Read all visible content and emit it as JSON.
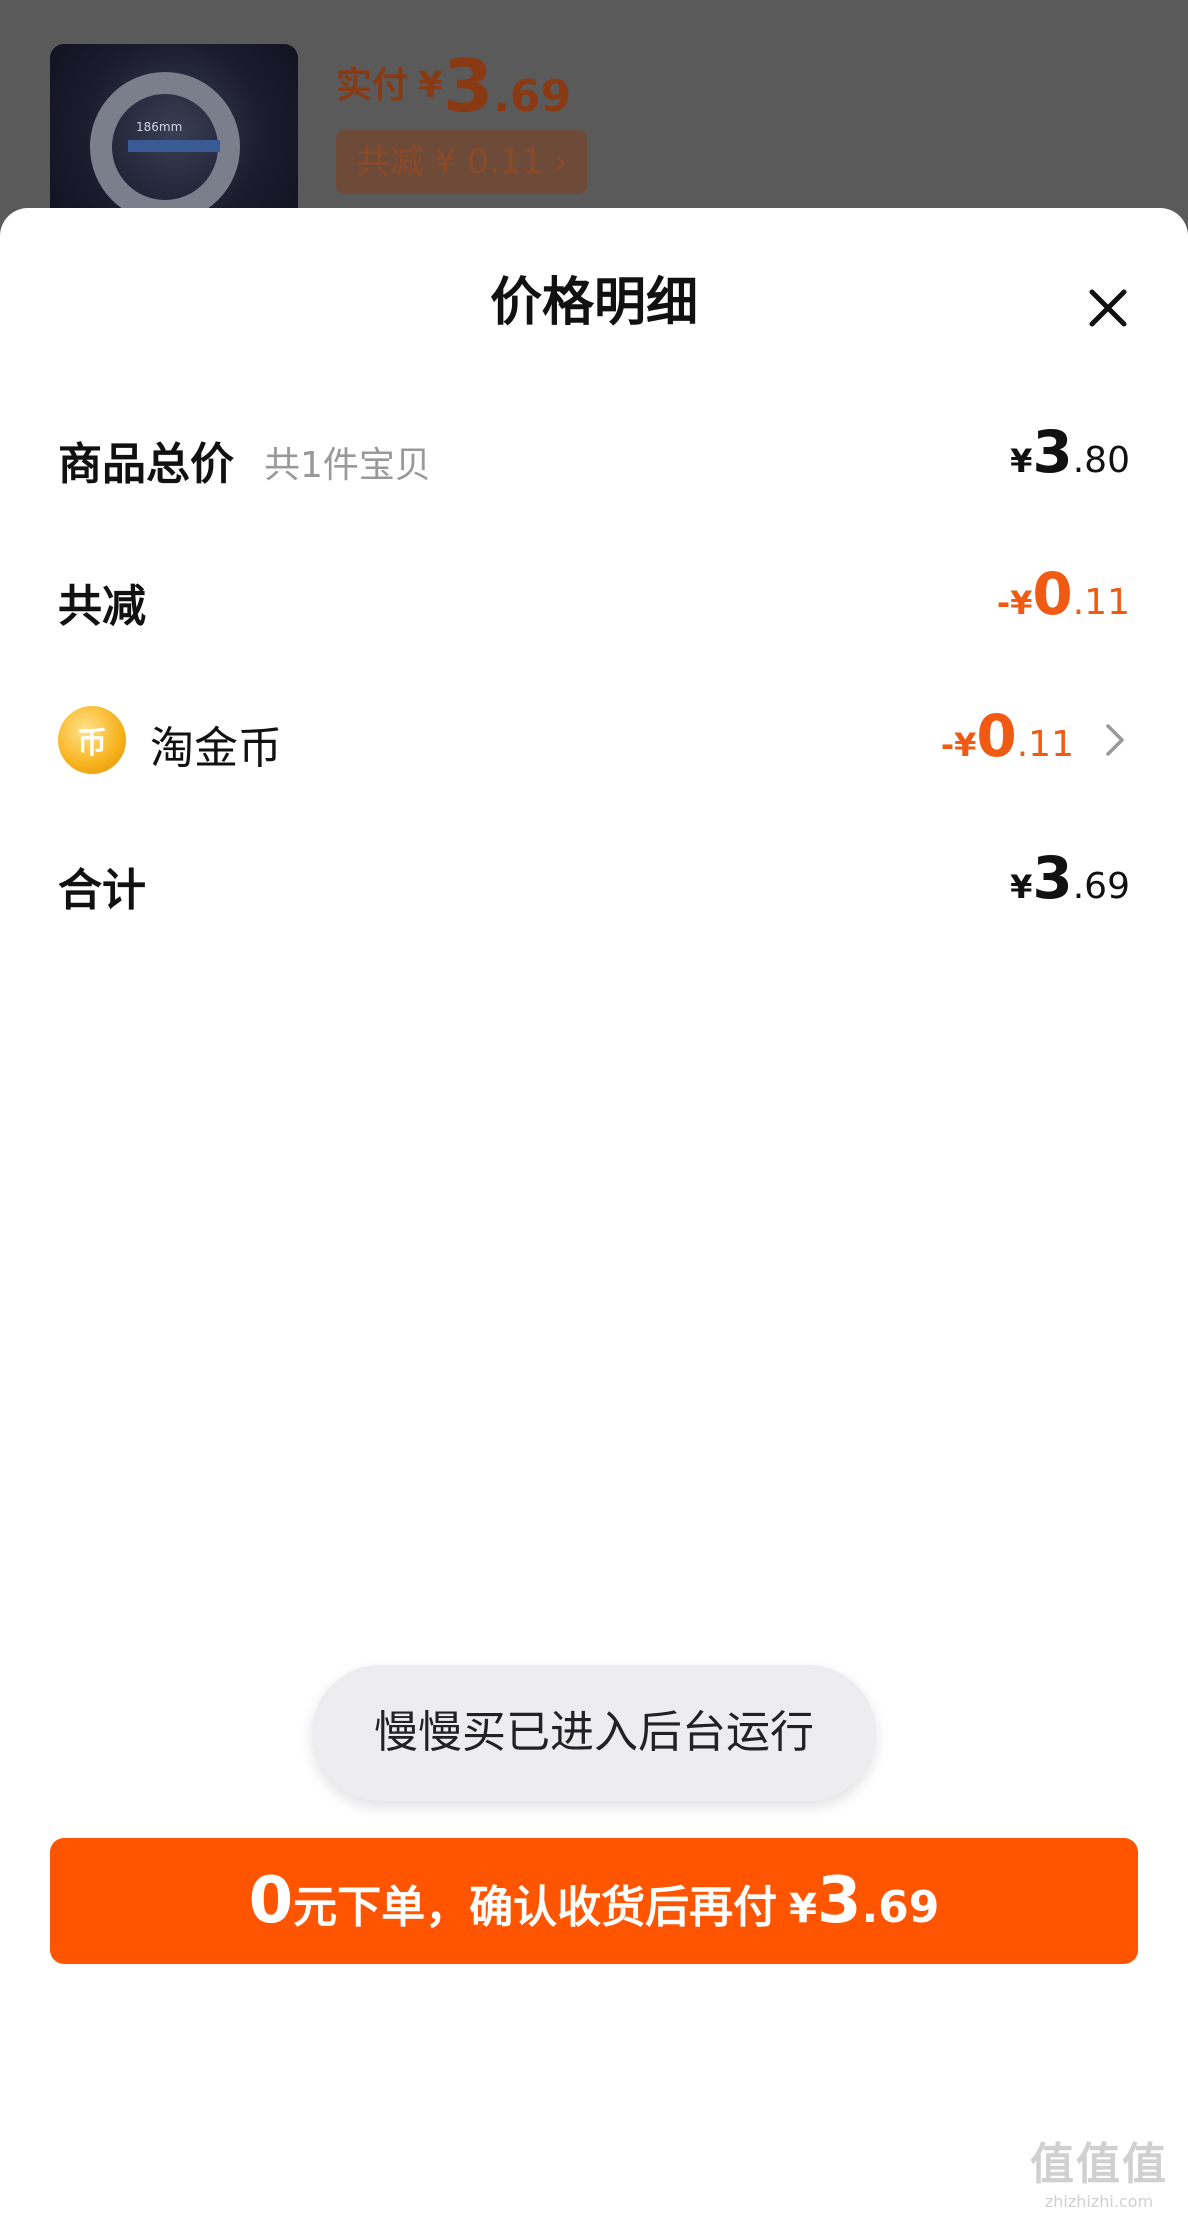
{
  "product": {
    "paid_label": "实付",
    "currency": "¥",
    "paid_int": "3",
    "paid_dec": ".69",
    "discount_chip": "共减 ¥ 0.11 ›",
    "thumb_label": "186mm"
  },
  "sheet": {
    "title": "价格明细",
    "rows": [
      {
        "label": "商品总价",
        "sub": "共1件宝贝",
        "sym": "¥",
        "int": "3",
        "dec": ".80"
      },
      {
        "label": "共减",
        "sym": "-¥",
        "int": "0",
        "dec": ".11"
      },
      {
        "label": "淘金币",
        "icon": "coin-icon",
        "coin_glyph": "币",
        "sym": "-¥",
        "int": "0",
        "dec": ".11"
      },
      {
        "label": "合计",
        "sym": "¥",
        "int": "3",
        "dec": ".69"
      }
    ]
  },
  "toast": "慢慢买已进入后台运行",
  "cta": {
    "zero": "0",
    "text": "元下单，确认收货后再付",
    "sym": "¥",
    "int": "3",
    "dec": ".69"
  },
  "watermark": {
    "main": "值值值",
    "sub": "zhizhizhi.com"
  },
  "colors": {
    "accent": "#ff5500",
    "discount": "#f05a12"
  }
}
